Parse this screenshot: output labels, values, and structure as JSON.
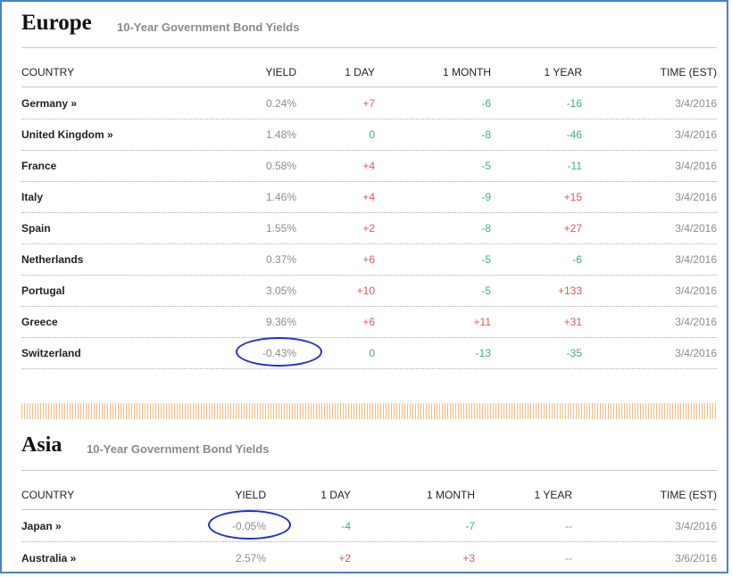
{
  "colors": {
    "frame": "#4f7fc7",
    "positive": "#e35858",
    "negative": "#3cae88",
    "stripe": "#f3b16b",
    "highlight_ellipse": "#1f2fd6"
  },
  "europe": {
    "title": "Europe",
    "subtitle": "10-Year Government Bond Yields",
    "headers": {
      "country": "COUNTRY",
      "yield": "YIELD",
      "day": "1 DAY",
      "month": "1 MONTH",
      "year": "1 YEAR",
      "time": "TIME (EST)"
    },
    "rows": [
      {
        "country": "Germany »",
        "yield": "0.24%",
        "day": "+7",
        "month": "-6",
        "year": "-16",
        "time": "3/4/2016"
      },
      {
        "country": "United Kingdom »",
        "yield": "1.48%",
        "day": "0",
        "month": "-8",
        "year": "-46",
        "time": "3/4/2016"
      },
      {
        "country": "France",
        "yield": "0.58%",
        "day": "+4",
        "month": "-5",
        "year": "-11",
        "time": "3/4/2016"
      },
      {
        "country": "Italy",
        "yield": "1.46%",
        "day": "+4",
        "month": "-9",
        "year": "+15",
        "time": "3/4/2016"
      },
      {
        "country": "Spain",
        "yield": "1.55%",
        "day": "+2",
        "month": "-8",
        "year": "+27",
        "time": "3/4/2016"
      },
      {
        "country": "Netherlands",
        "yield": "0.37%",
        "day": "+6",
        "month": "-5",
        "year": "-6",
        "time": "3/4/2016"
      },
      {
        "country": "Portugal",
        "yield": "3.05%",
        "day": "+10",
        "month": "-5",
        "year": "+133",
        "time": "3/4/2016"
      },
      {
        "country": "Greece",
        "yield": "9.36%",
        "day": "+6",
        "month": "+11",
        "year": "+31",
        "time": "3/4/2016"
      },
      {
        "country": "Switzerland",
        "yield": "-0.43%",
        "day": "0",
        "month": "-13",
        "year": "-35",
        "time": "3/4/2016"
      }
    ]
  },
  "asia": {
    "title": "Asia",
    "subtitle": "10-Year Government Bond Yields",
    "headers": {
      "country": "COUNTRY",
      "yield": "YIELD",
      "day": "1 DAY",
      "month": "1 MONTH",
      "year": "1 YEAR",
      "time": "TIME (EST)"
    },
    "rows": [
      {
        "country": "Japan »",
        "yield": "-0.05%",
        "day": "-4",
        "month": "-7",
        "year": "--",
        "time": "3/4/2016"
      },
      {
        "country": "Australia »",
        "yield": "2.57%",
        "day": "+2",
        "month": "+3",
        "year": "--",
        "time": "3/6/2016"
      }
    ]
  }
}
